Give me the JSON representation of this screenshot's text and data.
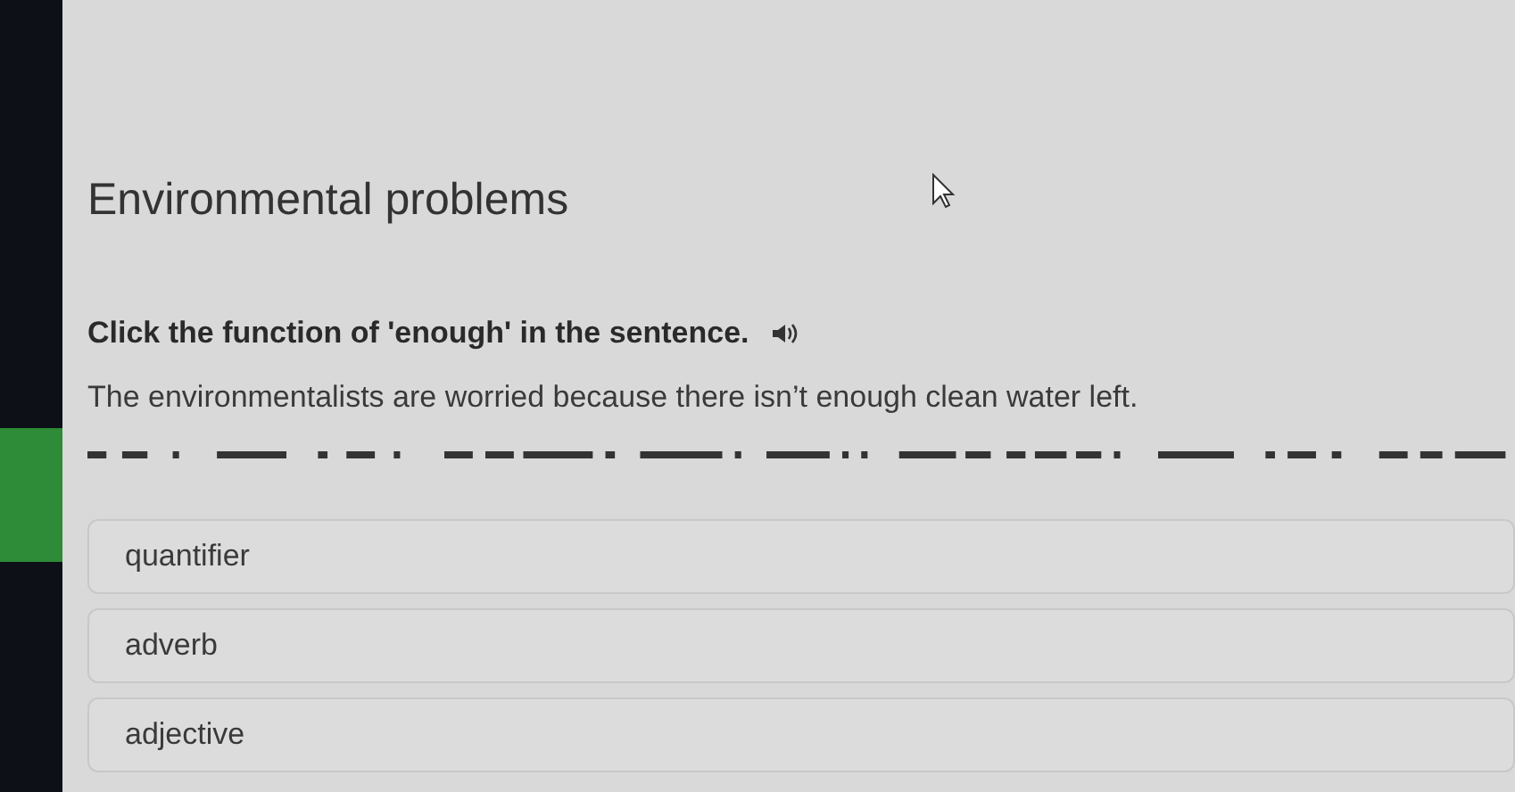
{
  "lesson": {
    "title": "Environmental problems"
  },
  "question": {
    "prompt": "Click the function of 'enough' in the sentence.",
    "sentence": "The environmentalists are worried because there isn’t enough clean water left."
  },
  "options": [
    {
      "label": "quantifier",
      "selected": false
    },
    {
      "label": "adverb",
      "selected": false
    },
    {
      "label": "adjective",
      "selected": false
    }
  ]
}
